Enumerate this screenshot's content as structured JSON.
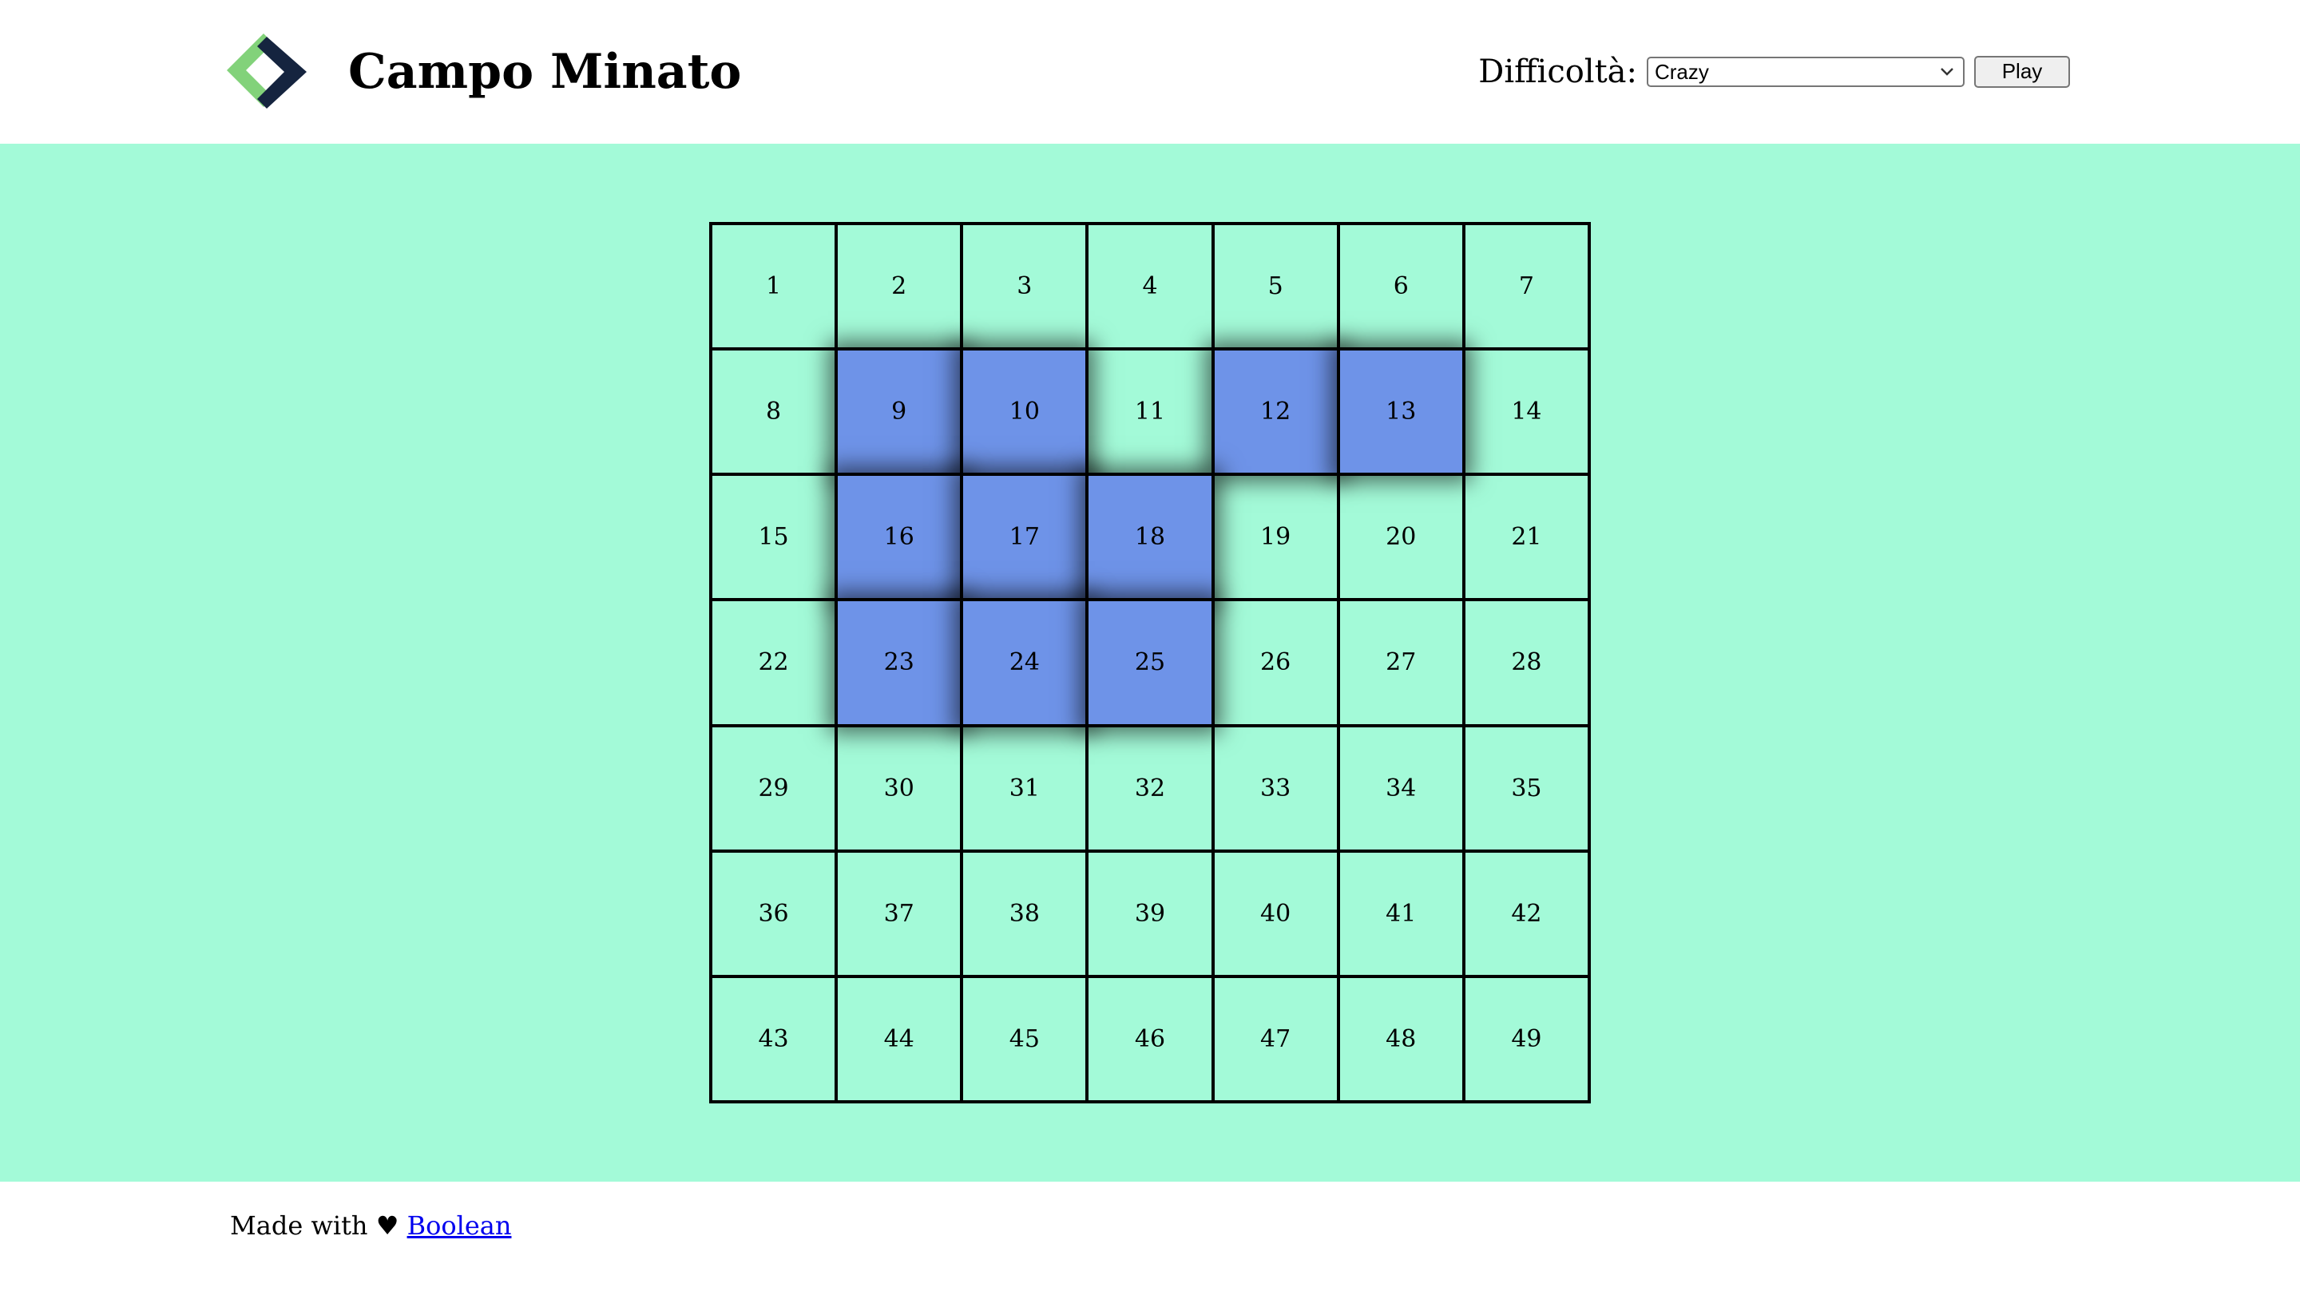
{
  "header": {
    "title": "Campo Minato",
    "difficulty_label": "Difficoltà:",
    "difficulty_selected": "Crazy",
    "play_label": "Play"
  },
  "board": {
    "columns": 7,
    "rows": 7,
    "cells": [
      "1",
      "2",
      "3",
      "4",
      "5",
      "6",
      "7",
      "8",
      "9",
      "10",
      "11",
      "12",
      "13",
      "14",
      "15",
      "16",
      "17",
      "18",
      "19",
      "20",
      "21",
      "22",
      "23",
      "24",
      "25",
      "26",
      "27",
      "28",
      "29",
      "30",
      "31",
      "32",
      "33",
      "34",
      "35",
      "36",
      "37",
      "38",
      "39",
      "40",
      "41",
      "42",
      "43",
      "44",
      "45",
      "46",
      "47",
      "48",
      "49"
    ],
    "revealed": [
      9,
      10,
      12,
      13,
      16,
      17,
      18,
      23,
      24,
      25
    ]
  },
  "footer": {
    "made_with": "Made with",
    "heart": "♥",
    "link_text": "Boolean"
  },
  "colors": {
    "background": "#a3fad8",
    "revealed_cell": "#6e93e8",
    "logo_green": "#82d27a",
    "logo_navy": "#15243f"
  },
  "icons": {
    "logo": "diamond-logo-icon",
    "select_arrow": "chevron-down-icon"
  }
}
